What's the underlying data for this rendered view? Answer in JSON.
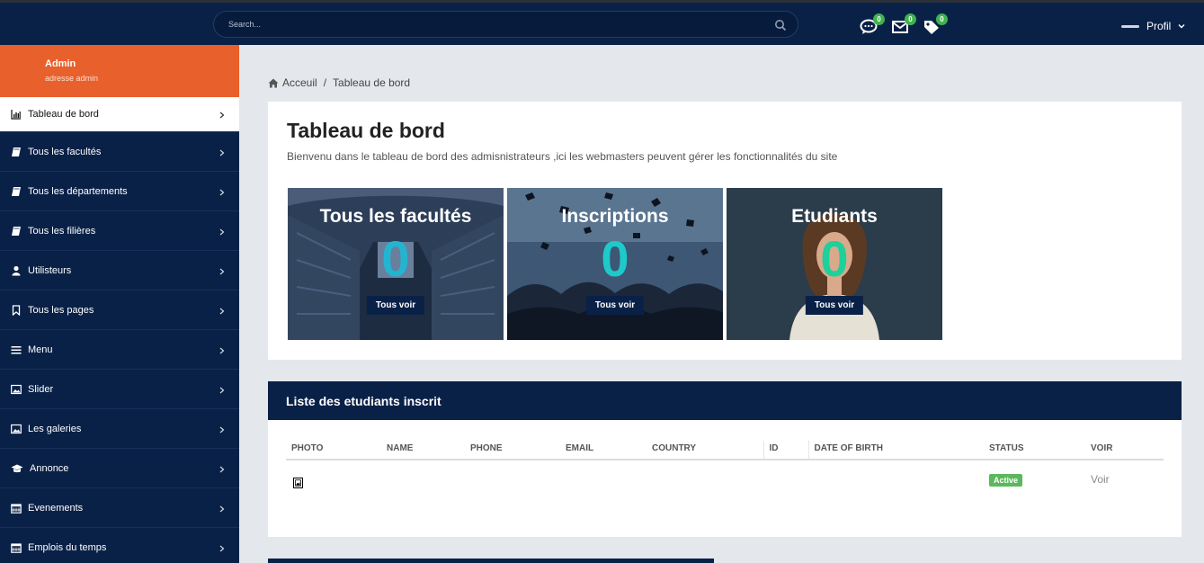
{
  "topbar": {
    "search_placeholder": "Search...",
    "badges": {
      "messages": "0",
      "mail": "0",
      "tags": "0"
    },
    "profile_label": "Profil"
  },
  "sidebar": {
    "user_name": "Admin",
    "user_sub": "adresse admin",
    "items": [
      {
        "label": "Tableau de bord",
        "icon": "bar-chart-icon"
      },
      {
        "label": "Tous les facultés",
        "icon": "book-icon"
      },
      {
        "label": "Tous les départements",
        "icon": "book-icon"
      },
      {
        "label": "Tous les filières",
        "icon": "book-icon"
      },
      {
        "label": "Utilisteurs",
        "icon": "user-icon"
      },
      {
        "label": "Tous les pages",
        "icon": "bookmark-icon"
      },
      {
        "label": "Menu",
        "icon": "menu-icon"
      },
      {
        "label": "Slider",
        "icon": "image-icon"
      },
      {
        "label": "Les galeries",
        "icon": "image-icon"
      },
      {
        "label": "Annonce",
        "icon": "graduation-cap-icon"
      },
      {
        "label": "Evenements",
        "icon": "calendar-icon"
      },
      {
        "label": "Emplois du temps",
        "icon": "calendar-icon"
      }
    ]
  },
  "breadcrumb": {
    "home": "Acceuil",
    "current": "Tableau de bord"
  },
  "dashboard": {
    "title": "Tableau de bord",
    "description": "Bienvenu dans le tableau de bord des admisnistrateurs ,ici les webmasters peuvent gérer les fonctionnalités du site",
    "cards": [
      {
        "title": "Tous les facultés",
        "count": "0",
        "button": "Tous voir",
        "count_color": "#22b5d2"
      },
      {
        "title": "Inscriptions",
        "count": "0",
        "button": "Tous voir",
        "count_color": "#1ec9c9"
      },
      {
        "title": "Etudiants",
        "count": "0",
        "button": "Tous voir",
        "count_color": "#1ed09a"
      }
    ]
  },
  "students": {
    "heading": "Liste des etudiants inscrit",
    "columns": [
      "PHOTO",
      "NAME",
      "PHONE",
      "EMAIL",
      "COUNTRY",
      "ID",
      "DATE OF BIRTH",
      "STATUS",
      "VOIR"
    ],
    "rows": [
      {
        "name": "",
        "phone": "",
        "email": "",
        "country": "",
        "id": "",
        "dob": "",
        "status": "Active",
        "voir": "Voir"
      }
    ]
  },
  "colors": {
    "navy": "#0a2147",
    "accent": "#e8602c",
    "badge_green": "#3fb34f"
  }
}
